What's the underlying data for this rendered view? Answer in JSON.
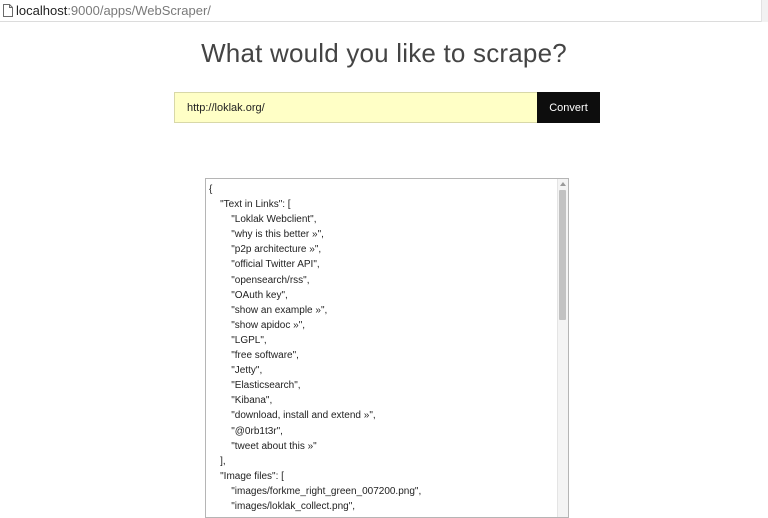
{
  "browser": {
    "url_host": "localhost",
    "url_rest": ":9000/apps/WebScraper/",
    "page_icon": "document-icon"
  },
  "main": {
    "title": "What would you like to scrape?",
    "input_value": "http://loklak.org/",
    "convert_label": "Convert",
    "output_lines": [
      "{",
      "    \"Text in Links\": [",
      "        \"Loklak Webclient\",",
      "        \"why is this better »\",",
      "        \"p2p architecture »\",",
      "        \"official Twitter API\",",
      "        \"opensearch/rss\",",
      "        \"OAuth key\",",
      "        \"show an example »\",",
      "        \"show apidoc »\",",
      "        \"LGPL\",",
      "        \"free software\",",
      "        \"Jetty\",",
      "        \"Elasticsearch\",",
      "        \"Kibana\",",
      "        \"download, install and extend »\",",
      "        \"@0rb1t3r\",",
      "        \"tweet about this »\"",
      "    ],",
      "    \"Image files\": [",
      "        \"images/forkme_right_green_007200.png\",",
      "        \"images/loklak_collect.png\","
    ]
  },
  "colors": {
    "input_background": "#ffffc6",
    "button_background": "#0d0d0d",
    "title_color": "#444444"
  }
}
